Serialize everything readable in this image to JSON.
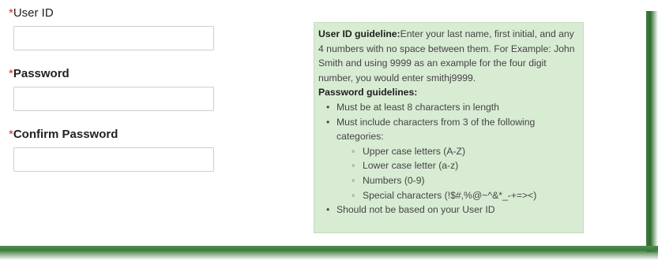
{
  "form": {
    "required_mark": "*",
    "user_id": {
      "label": "User ID",
      "value": ""
    },
    "password": {
      "label": "Password",
      "value": ""
    },
    "confirm_password": {
      "label": "Confirm Password",
      "value": ""
    }
  },
  "guidelines": {
    "userid_title": "User ID guideline:",
    "userid_text": "Enter your last name, first initial, and any 4 numbers with no space between them. For Example: John Smith and using 9999 as an example for the four digit number, you would enter smithj9999.",
    "password_title": "Password guidelines:",
    "rules": [
      "Must be at least 8 characters in length",
      "Must include characters from 3 of the following categories:",
      "Should not be based on your User ID"
    ],
    "categories": [
      "Upper case letters (A-Z)",
      "Lower case letter (a-z)",
      "Numbers (0-9)",
      "Special characters (!$#,%@~^&*_-+=><)"
    ]
  },
  "colors": {
    "required": "#d0292b",
    "guide_background": "#d8ecd3",
    "shadow": "#2f6b2f"
  }
}
